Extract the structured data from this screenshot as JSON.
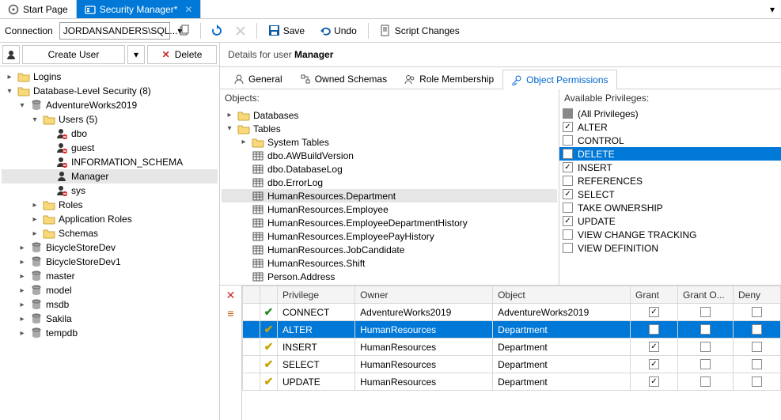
{
  "tabs": {
    "start": "Start Page",
    "security": "Security Manager*"
  },
  "toolbar": {
    "connection_label": "Connection",
    "connection_value": "JORDANSANDERS\\SQL...",
    "save": "Save",
    "undo": "Undo",
    "script": "Script Changes"
  },
  "left_actions": {
    "create": "Create User",
    "delete": "Delete"
  },
  "tree": {
    "logins": "Logins",
    "db_sec": "Database-Level Security  (8)",
    "aw": "AdventureWorks2019",
    "users": "Users (5)",
    "user_list": [
      "dbo",
      "guest",
      "INFORMATION_SCHEMA",
      "Manager",
      "sys"
    ],
    "roles": "Roles",
    "app_roles": "Application Roles",
    "schemas": "Schemas",
    "dbs": [
      "BicycleStoreDev",
      "BicycleStoreDev1",
      "master",
      "model",
      "msdb",
      "Sakila",
      "tempdb"
    ]
  },
  "details": {
    "prefix": "Details for user ",
    "user": "Manager"
  },
  "subtabs": {
    "general": "General",
    "owned": "Owned Schemas",
    "role": "Role Membership",
    "perms": "Object Permissions"
  },
  "objects": {
    "label": "Objects:",
    "databases": "Databases",
    "tables": "Tables",
    "system_tables": "System Tables",
    "list": [
      "dbo.AWBuildVersion",
      "dbo.DatabaseLog",
      "dbo.ErrorLog",
      "HumanResources.Department",
      "HumanResources.Employee",
      "HumanResources.EmployeeDepartmentHistory",
      "HumanResources.EmployeePayHistory",
      "HumanResources.JobCandidate",
      "HumanResources.Shift",
      "Person.Address",
      "Person.AddressType"
    ],
    "selected_index": 3
  },
  "privileges": {
    "label": "Available Privileges:",
    "all": "(All Privileges)",
    "items": [
      {
        "name": "ALTER",
        "checked": true
      },
      {
        "name": "CONTROL",
        "checked": false
      },
      {
        "name": "DELETE",
        "checked": true,
        "selected": true
      },
      {
        "name": "INSERT",
        "checked": true
      },
      {
        "name": "REFERENCES",
        "checked": false
      },
      {
        "name": "SELECT",
        "checked": true
      },
      {
        "name": "TAKE OWNERSHIP",
        "checked": false
      },
      {
        "name": "UPDATE",
        "checked": true
      },
      {
        "name": "VIEW CHANGE TRACKING",
        "checked": false
      },
      {
        "name": "VIEW DEFINITION",
        "checked": false
      }
    ]
  },
  "grid": {
    "cols": {
      "priv": "Privilege",
      "owner": "Owner",
      "object": "Object",
      "grant": "Grant",
      "granto": "Grant O...",
      "deny": "Deny"
    },
    "rows": [
      {
        "priv": "CONNECT",
        "owner": "AdventureWorks2019",
        "object": "AdventureWorks2019",
        "grant": true,
        "new": false
      },
      {
        "priv": "ALTER",
        "owner": "HumanResources",
        "object": "Department",
        "grant": true,
        "new": true,
        "selected": true
      },
      {
        "priv": "INSERT",
        "owner": "HumanResources",
        "object": "Department",
        "grant": true,
        "new": true
      },
      {
        "priv": "SELECT",
        "owner": "HumanResources",
        "object": "Department",
        "grant": true,
        "new": true
      },
      {
        "priv": "UPDATE",
        "owner": "HumanResources",
        "object": "Department",
        "grant": true,
        "new": true
      }
    ]
  }
}
